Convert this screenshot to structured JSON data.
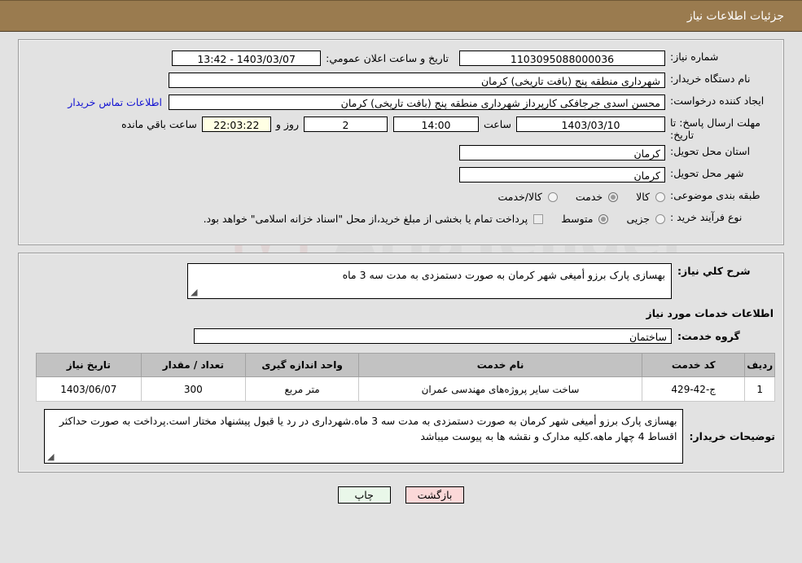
{
  "header": {
    "title": "جزئیات اطلاعات نیاز"
  },
  "form": {
    "need_number_label": "شماره نیاز:",
    "need_number_value": "1103095088000036",
    "public_announce_label": "تاریخ و ساعت اعلان عمومي:",
    "public_announce_value": "1403/03/07 - 13:42",
    "buyer_org_label": "نام دستگاه خریدار:",
    "buyer_org_value": "شهرداری منطقه پنج (بافت تاریخی) کرمان",
    "creator_label": "ایجاد کننده درخواست:",
    "creator_value": "محسن اسدی جرجافکی کارپرداز شهرداری منطقه پنج (بافت تاریخی) کرمان",
    "contact_link": "اطلاعات تماس خریدار",
    "deadline_label": "مهلت ارسال پاسخ: تا تاریخ:",
    "deadline_date": "1403/03/10",
    "hour_label": "ساعت",
    "hour_value": "14:00",
    "days_value": "2",
    "days_label": "روز و",
    "countdown_value": "22:03:22",
    "remaining_label": "ساعت باقي مانده",
    "province_label": "استان محل تحویل:",
    "province_value": "کرمان",
    "city_label": "شهر محل تحویل:",
    "city_value": "کرمان",
    "category_label": "طبقه بندی موضوعی:",
    "category_options": [
      {
        "label": "کالا",
        "selected": false
      },
      {
        "label": "خدمت",
        "selected": true
      },
      {
        "label": "کالا/خدمت",
        "selected": false
      }
    ],
    "process_label": "نوع فرآیند خرید :",
    "process_options": [
      {
        "label": "جزیی",
        "selected": false
      },
      {
        "label": "متوسط",
        "selected": true
      }
    ],
    "treasury_checkbox_label": "پرداخت تمام یا بخشی از مبلغ خرید،از محل \"اسناد خزانه اسلامی\" خواهد بود.",
    "treasury_checked": false
  },
  "details": {
    "general_desc_label": "شرح كلي نیاز:",
    "general_desc_value": "بهسازی پارک برزو أمیغی شهر کرمان به صورت دستمزدی به مدت سه 3 ماه",
    "services_section_title": "اطلاعات خدمات مورد نیاز",
    "service_group_label": "گروه خدمت:",
    "service_group_value": "ساختمان",
    "table": {
      "columns": [
        "ردیف",
        "کد خدمت",
        "نام خدمت",
        "واحد اندازه گیری",
        "تعداد / مقدار",
        "تاریخ نیاز"
      ],
      "rows": [
        {
          "index": "1",
          "code": "ج-42-429",
          "name": "ساخت سایر پروژه‌های مهندسی عمران",
          "unit": "متر مربع",
          "qty": "300",
          "date": "1403/06/07"
        }
      ]
    },
    "buyer_notes_label": "توضیحات خریدار:",
    "buyer_notes_value": "بهسازی پارک برزو أمیغی شهر کرمان به صورت دستمزدی به مدت سه 3 ماه.شهرداری در رد یا قبول پیشنهاد مختار است.پرداخت به صورت حداکثر اقساط 4 چهار ماهه.کلیه مدارک و نقشه ها به پیوست میباشد"
  },
  "footer": {
    "print_label": "چاپ",
    "back_label": "بازگشت"
  },
  "watermark": {
    "text": "AriaTender.net"
  },
  "colors": {
    "titlebar_bg": "#9a7b4f",
    "page_bg": "#e2e2e2",
    "link": "#1414d2",
    "table_header_bg": "#c2c2c2",
    "print_btn_bg": "#e9f7e9",
    "back_btn_bg": "#fbd8d8",
    "countdown_bg": "#ffffe4"
  }
}
